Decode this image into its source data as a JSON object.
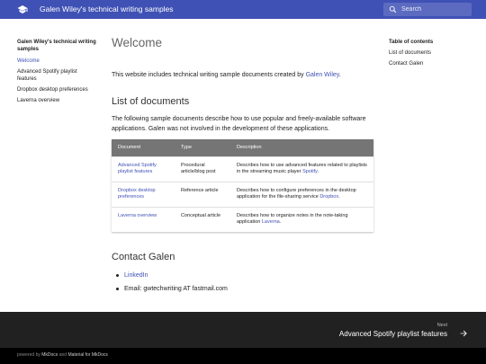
{
  "header": {
    "site_title": "Galen Wiley's technical writing samples",
    "search_placeholder": "Search",
    "brand_color": "#3f51b5"
  },
  "nav": {
    "title": "Galen Wiley's technical writing samples",
    "items": [
      {
        "label": "Welcome",
        "active": true
      },
      {
        "label": "Advanced Spotify playlist features",
        "active": false
      },
      {
        "label": "Dropbox desktop preferences",
        "active": false
      },
      {
        "label": "Laverna overview",
        "active": false
      }
    ]
  },
  "toc": {
    "title": "Table of contents",
    "items": [
      "List of documents",
      "Contact Galen"
    ]
  },
  "main": {
    "title": "Welcome",
    "intro_prefix": "This website includes technical writing sample documents created by ",
    "intro_link": "Galen Wiley",
    "intro_suffix": ".",
    "docs_heading": "List of documents",
    "docs_text": "The following sample documents describe how to use popular and freely-available software applications. Galen was not involved in the development of these applications.",
    "table": {
      "headers": [
        "Document",
        "Type",
        "Description"
      ],
      "rows": [
        {
          "doc": "Advanced Spotify playlist features",
          "type": "Procedural article/blog post",
          "desc_prefix": "Describes how to use advanced features related to playlists in the streaming music player ",
          "desc_link": "Spotify",
          "desc_suffix": "."
        },
        {
          "doc": "Dropbox desktop preferences",
          "type": "Reference article",
          "desc_prefix": "Describes how to configure preferences in the desktop application for the file-sharing service ",
          "desc_link": "Dropbox",
          "desc_suffix": "."
        },
        {
          "doc": "Laverna overview",
          "type": "Conceptual article",
          "desc_prefix": "Describes how to organize notes in the note-taking application ",
          "desc_link": "Laverna",
          "desc_suffix": "."
        }
      ]
    },
    "contact_heading": "Contact Galen",
    "contact_linkedin": "LinkedIn",
    "contact_email": "Email: gwtechwriting AT fastmail.com"
  },
  "footer": {
    "next_label": "Next",
    "next_title": "Advanced Spotify playlist features",
    "meta_prefix": "powered by ",
    "meta_link1": "MkDocs",
    "meta_mid": " and ",
    "meta_link2": "Material for MkDocs"
  }
}
